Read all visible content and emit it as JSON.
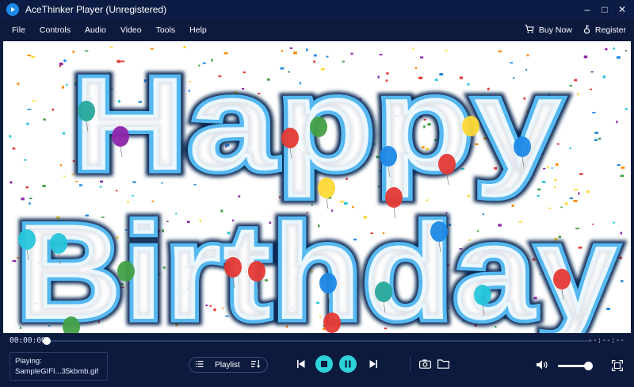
{
  "window": {
    "title": "AceThinker Player (Unregistered)",
    "minimize": "–",
    "maximize": "□",
    "close": "✕"
  },
  "menu": {
    "items": [
      "File",
      "Controls",
      "Audio",
      "Video",
      "Tools",
      "Help"
    ],
    "buy_now": "Buy Now",
    "register": "Register"
  },
  "video": {
    "line1": "Happy",
    "line2": "Birthday"
  },
  "playback": {
    "current_time": "00:00:00",
    "total_time": "--:--:--",
    "progress": 0
  },
  "now_playing": {
    "label": "Playing:",
    "file": "SampleGIFI...35kbmb.gif"
  },
  "playlist": {
    "label": "Playlist"
  },
  "volume": {
    "level": 0.9
  },
  "colors": {
    "background": "#0b1a3d",
    "accent": "#2bd3d9",
    "text_outline": "#3b9be0"
  }
}
